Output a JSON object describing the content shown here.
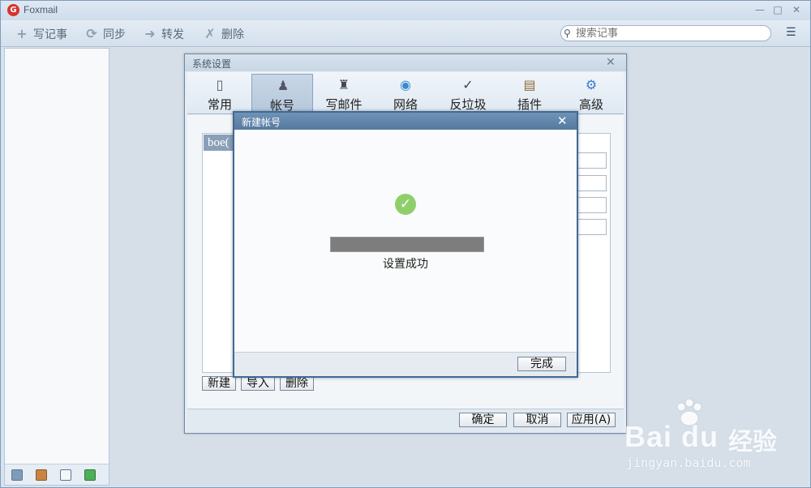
{
  "window": {
    "title": "Foxmail",
    "logo_glyph": "G"
  },
  "toolbar": {
    "items": [
      {
        "label": "写记事",
        "icon": "plus-icon"
      },
      {
        "label": "同步",
        "icon": "sync-icon"
      },
      {
        "label": "转发",
        "icon": "forward-arrow-icon"
      },
      {
        "label": "删除",
        "icon": "delete-icon"
      }
    ],
    "search_placeholder": "搜索记事"
  },
  "settings_dialog": {
    "title": "系统设置",
    "tabs": [
      {
        "label": "常用",
        "icon": "general-icon",
        "active": false
      },
      {
        "label": "帐号",
        "icon": "account-icon",
        "active": true
      },
      {
        "label": "写邮件",
        "icon": "compose-icon",
        "active": false
      },
      {
        "label": "网络",
        "icon": "network-globe-icon",
        "active": false
      },
      {
        "label": "反垃圾",
        "icon": "antispam-shield-icon",
        "active": false
      },
      {
        "label": "插件",
        "icon": "plugin-box-icon",
        "active": false
      },
      {
        "label": "高级",
        "icon": "advanced-gear-icon",
        "active": false
      }
    ],
    "account_item": "boe(",
    "buttons": {
      "new": "新建",
      "import": "导入",
      "delete": "删除"
    },
    "footer": {
      "ok": "确定",
      "cancel": "取消",
      "apply": "应用(A)"
    }
  },
  "new_account_dialog": {
    "title": "新建帐号",
    "status": "设置成功",
    "progress": 1.0,
    "finish": "完成"
  },
  "watermark": {
    "brand": "Bai du",
    "brand_cn": "经验",
    "url": "jingyan.baidu.com"
  },
  "colors": {
    "accent": "#56799f",
    "success": "#8fcf6b",
    "progress": "#7d7d7d"
  }
}
